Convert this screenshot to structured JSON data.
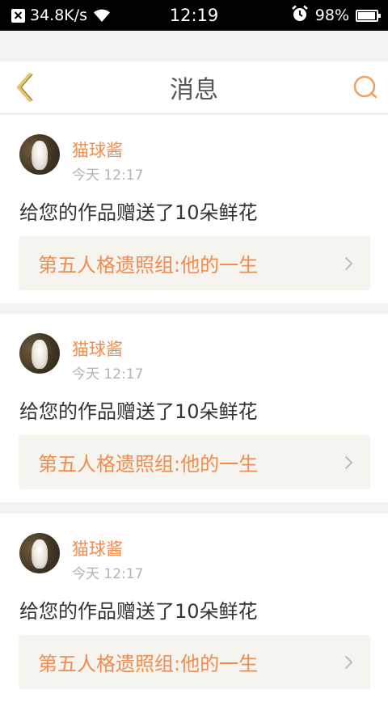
{
  "status_bar": {
    "network_speed": "34.8K/s",
    "time": "12:19",
    "battery": "98%"
  },
  "nav": {
    "title": "消息",
    "back_icon": "chevron-left-icon",
    "search_icon": "search-icon"
  },
  "colors": {
    "accent": "#f08c50",
    "back_icon": "#e8c66a",
    "title": "#555555",
    "card_link_bg": "#f5f4ee"
  },
  "messages": [
    {
      "username": "猫球酱",
      "time": "今天 12:17",
      "text": "给您的作品赠送了10朵鲜花",
      "work_title": "第五人格遗照组:他的一生"
    },
    {
      "username": "猫球酱",
      "time": "今天 12:17",
      "text": "给您的作品赠送了10朵鲜花",
      "work_title": "第五人格遗照组:他的一生"
    },
    {
      "username": "猫球酱",
      "time": "今天 12:17",
      "text": "给您的作品赠送了10朵鲜花",
      "work_title": "第五人格遗照组:他的一生"
    }
  ]
}
